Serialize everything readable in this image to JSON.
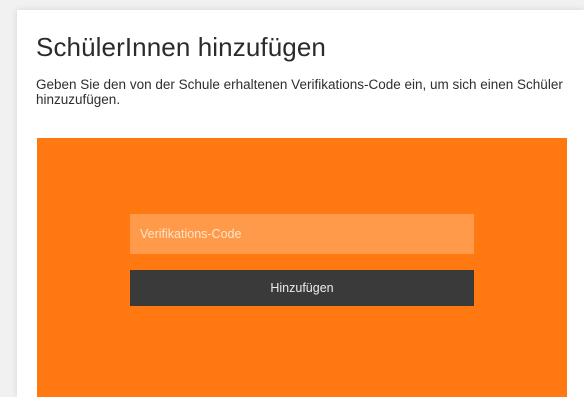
{
  "page": {
    "title": "SchülerInnen hinzufügen",
    "description": "Geben Sie den von der Schule erhaltenen Verifikations-Code ein, um sich einen Schüler hinzuzufügen."
  },
  "form": {
    "code_placeholder": "Verifikations-Code",
    "code_value": "",
    "submit_label": "Hinzufügen"
  },
  "colors": {
    "panel": "#ff7811",
    "input": "#ff9a4a",
    "button": "#3a3a3a"
  }
}
